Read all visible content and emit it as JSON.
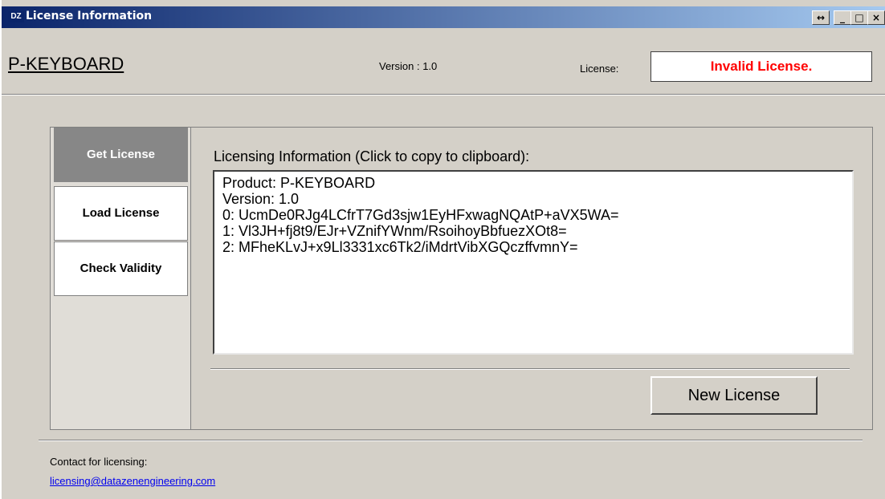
{
  "window": {
    "app_badge": "DZ",
    "title": "License Information",
    "controls": {
      "resize_glyph": "↔",
      "minimize_glyph": "_",
      "maximize_glyph": "□",
      "close_glyph": "×"
    }
  },
  "header": {
    "product_name": "P-KEYBOARD",
    "version_text": "Version : 1.0",
    "license_label": "License:",
    "license_status": "Invalid License.",
    "license_status_color": "#ff0000"
  },
  "tabs": [
    {
      "label": "Get License",
      "active": true
    },
    {
      "label": "Load License",
      "active": false
    },
    {
      "label": "Check Validity",
      "active": false
    }
  ],
  "content": {
    "label": "Licensing Information (Click to copy to clipboard):",
    "info_lines": [
      "Product: P-KEYBOARD",
      "Version: 1.0",
      "0: UcmDe0RJg4LCfrT7Gd3sjw1EyHFxwagNQAtP+aVX5WA=",
      "1: Vl3JH+fj8t9/EJr+VZnifYWnm/RsoihoyBbfuezXOt8=",
      "2: MFheKLvJ+x9Ll3331xc6Tk2/iMdrtVibXGQczffvmnY="
    ],
    "new_license_button": "New License"
  },
  "footer": {
    "contact_label": "Contact for licensing:",
    "contact_email": "licensing@datazenengineering.com"
  },
  "colors": {
    "titlebar_start": "#0a246a",
    "titlebar_end": "#a6caf0",
    "active_tab": "#878787",
    "window_bg": "#d4d0c8",
    "link": "#0000ee"
  }
}
